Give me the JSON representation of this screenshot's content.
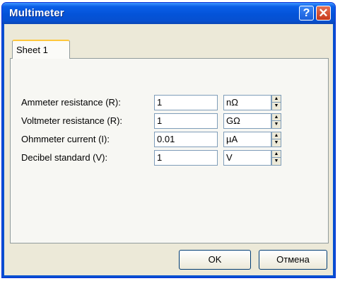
{
  "window": {
    "title": "Multimeter",
    "help_label": "?",
    "close_label": "✕"
  },
  "tabs": [
    {
      "label": "Sheet 1"
    }
  ],
  "fields": [
    {
      "label": "Ammeter resistance (R):",
      "value": "1",
      "unit": "nΩ"
    },
    {
      "label": "Voltmeter resistance (R):",
      "value": "1",
      "unit": "GΩ"
    },
    {
      "label": "Ohmmeter current (I):",
      "value": "0.01",
      "unit": "µA"
    },
    {
      "label": "Decibel standard (V):",
      "value": "1",
      "unit": "V"
    }
  ],
  "buttons": {
    "ok": "OK",
    "cancel": "Отмена"
  },
  "icons": {
    "spin_up": "spin-up-icon",
    "spin_down": "spin-down-icon"
  }
}
